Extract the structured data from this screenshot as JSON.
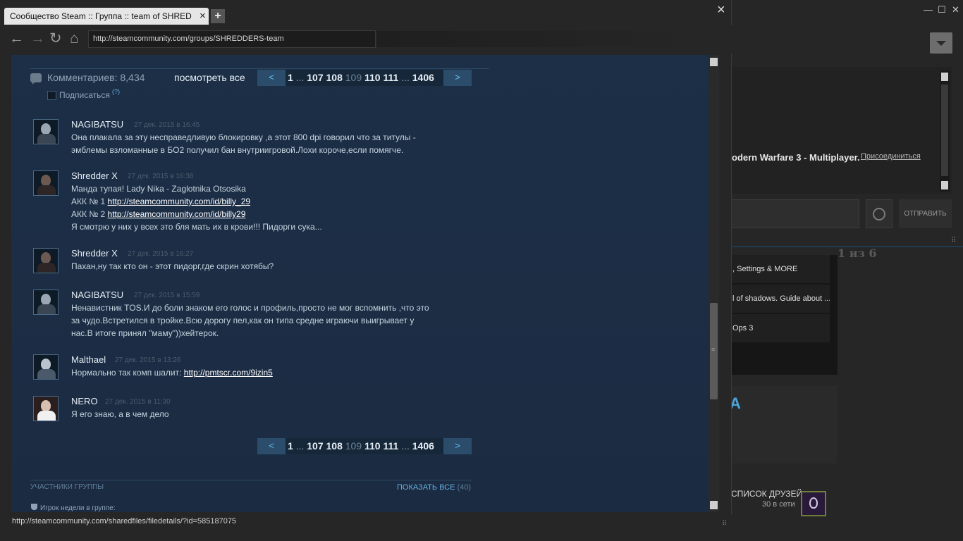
{
  "browser": {
    "tab_title": "Сообщество Steam :: Группа :: team of SHREDDE...",
    "new_tab": "+",
    "tab_close": "×",
    "window_close": "×",
    "url": "http://steamcommunity.com/groups/SHREDDERS-team",
    "status_url": "http://steamcommunity.com/sharedfiles/filedetails/?id=585187075"
  },
  "comments_header": {
    "count_label": "Комментариев: 8,434",
    "view_all": "посмотреть все",
    "subscribe": "Подписаться",
    "help": "(?)"
  },
  "pagination": {
    "prev": "<",
    "next": ">",
    "first": "1",
    "dots": "...",
    "before": [
      "107",
      "108"
    ],
    "current": "109",
    "after": [
      "110",
      "111"
    ],
    "last": "1406"
  },
  "comments": [
    {
      "author": "NAGIBATSU",
      "time": "27 дек. 2015 в 16:45",
      "lines": [
        "Она плакала за эту несправедливую блокировку ,а этот 800 dpi говорил что за титулы -",
        "эмблемы взломанные в БО2 получил бан внутриигровой.Лохи короче,если помягче."
      ]
    },
    {
      "author": "Shredder X",
      "time": "27 дек. 2015 в 16:38",
      "line1": "Манда тупая! Lady Nika - Zaglotnika Otsosika",
      "acc1_label": "АКК № 1",
      "acc1_link": "http://steamcommunity.com/id/billy_29",
      "acc2_label": "АКК № 2",
      "acc2_link": "http://steamcommunity.com/id/billy29",
      "line4": "Я смотрю у них у всех это бля мать их в крови!!! Пидорги сука..."
    },
    {
      "author": "Shredder X",
      "time": "27 дек. 2015 в 16:27",
      "lines": [
        "Пахан,ну так кто он - этот пидорг,где скрин хотябы?"
      ]
    },
    {
      "author": "NAGIBATSU",
      "time": "27 дек. 2015 в 15:59",
      "lines": [
        "Ненавистник TOS.И до боли знаком его голос и профиль,просто не мог вспомнить ,что это",
        "за чудо.Встретился в тройке.Всю дорогу пел,как он типа средне играючи выигрывает у",
        "нас.В итоге принял \"маму\"))хейтерок."
      ]
    },
    {
      "author": "Malthael",
      "time": "27 дек. 2015 в 13:26",
      "text": "Нормально так комп шалит:",
      "link": "http://pmtscr.com/9izin5"
    },
    {
      "author": "NERO",
      "time": "27 дек. 2015 в 11:30",
      "lines": [
        "Я его знаю, а в чем дело"
      ]
    }
  ],
  "members": {
    "label": "УЧАСТНИКИ ГРУППЫ",
    "show_all": "ПОКАЗАТЬ ВСЕ",
    "count": "(40)",
    "player_of_week": "Игрок недели в группе:"
  },
  "background_window": {
    "minimize": "—",
    "maximize": "☐",
    "close": "✕",
    "game_text": "odern Warfare 3 - Multiplayer.",
    "join": "Присоединиться",
    "send": "ОТПРАВИТЬ",
    "pager": "1 из 6",
    "list_items": [
      ", Settings & MORE",
      "l of shadows. Guide about ...",
      "Ops 3"
    ],
    "accent_glyph": "A",
    "friends_label": "СПИСОК ДРУЗЕЙ",
    "friends_online": "30 в сети"
  },
  "colors": {
    "content_bg": "#1b2d45",
    "link_blue": "#66c0f4",
    "pager_btn": "#2c4c6c",
    "author_text": "#e6eef5",
    "body_text": "#c6d4df"
  }
}
